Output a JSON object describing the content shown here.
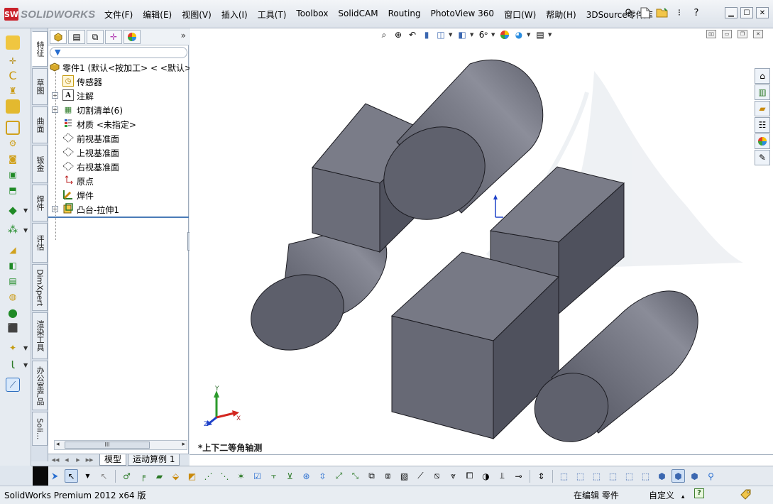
{
  "app": {
    "logo_text": "SOLIDWORKS",
    "logo_mark": "SW"
  },
  "menu": {
    "items": [
      "文件(F)",
      "编辑(E)",
      "视图(V)",
      "插入(I)",
      "工具(T)",
      "Toolbox",
      "SolidCAM",
      "Routing",
      "PhotoView 360",
      "窗口(W)",
      "帮助(H)",
      "3DSource零件库"
    ]
  },
  "vertical_tabs": [
    "特征",
    "草图",
    "曲面",
    "钣金",
    "焊件",
    "评估",
    "DimXpert",
    "渲染工具",
    "办公室产品",
    "Soli..."
  ],
  "feature_tree": {
    "root": "零件1  (默认<按加工> < <默认>_",
    "items": [
      {
        "label": "传感器",
        "icon": "sensor-icon",
        "expandable": false
      },
      {
        "label": "注解",
        "icon": "annotations-icon",
        "expandable": true
      },
      {
        "label": "切割清单(6)",
        "icon": "cut-list-icon",
        "expandable": true
      },
      {
        "label": "材质 <未指定>",
        "icon": "material-icon",
        "expandable": false
      },
      {
        "label": "前视基准面",
        "icon": "plane-icon",
        "expandable": false
      },
      {
        "label": "上视基准面",
        "icon": "plane-icon",
        "expandable": false
      },
      {
        "label": "右视基准面",
        "icon": "plane-icon",
        "expandable": false
      },
      {
        "label": "原点",
        "icon": "origin-icon",
        "expandable": false
      },
      {
        "label": "焊件",
        "icon": "weldment-icon",
        "expandable": false
      },
      {
        "label": "凸台-拉伸1",
        "icon": "extrude-icon",
        "expandable": true
      }
    ],
    "scroll_thumb": "III"
  },
  "model_tabs": [
    "模型",
    "运动算例 1"
  ],
  "viewport": {
    "view_label": "*上下二等角轴测",
    "triad": {
      "x": "X",
      "y": "Y",
      "z": "Z"
    }
  },
  "status": {
    "product": "SolidWorks Premium 2012 x64 版",
    "editing": "在编辑 零件",
    "units": "自定义",
    "units_arrow": "▴",
    "help": "?"
  }
}
